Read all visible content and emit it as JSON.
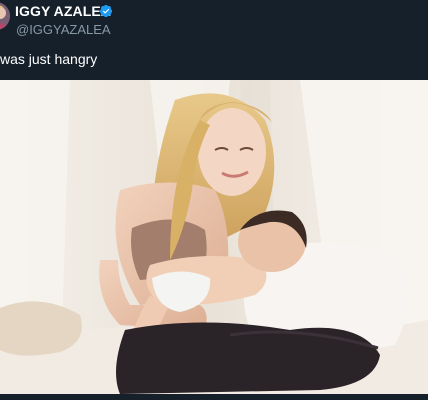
{
  "tweet": {
    "display_name": "IGGY AZALEA",
    "handle": "@IGGYAZALEA",
    "verified": true,
    "text": "was just hangry",
    "avatar_icon": "profile-avatar",
    "verified_icon": "verified-badge-icon"
  },
  "media": {
    "description_icon": "photo"
  },
  "colors": {
    "background": "#15202b",
    "name": "#ffffff",
    "handle": "#8899a6",
    "verified": "#1d9bf0"
  }
}
